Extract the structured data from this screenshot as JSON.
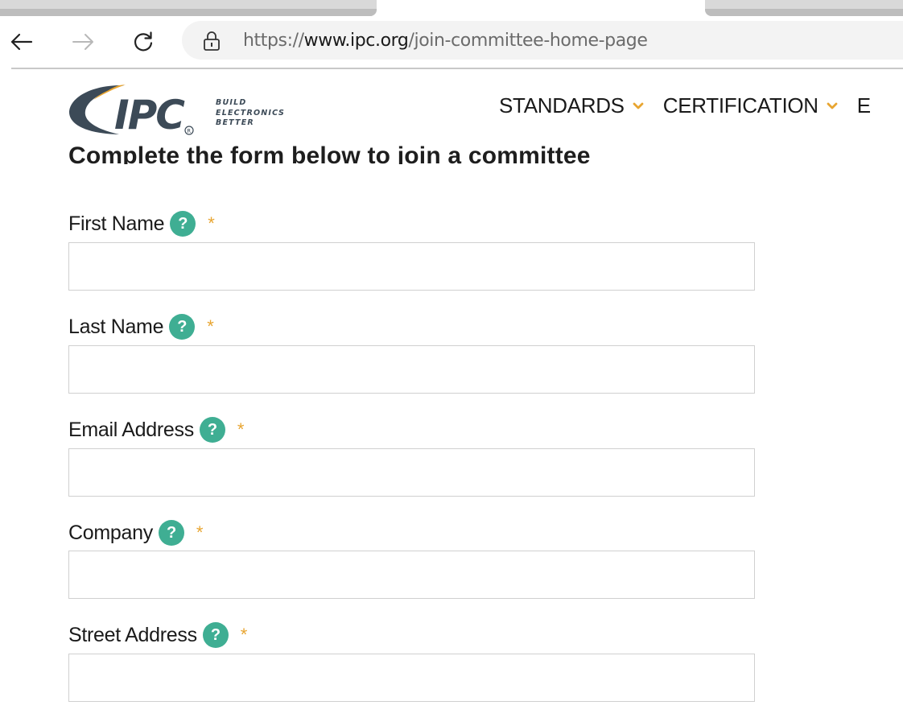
{
  "browser": {
    "url_protocol": "https://",
    "url_host": "www.ipc.org",
    "url_path": "/join-committee-home-page"
  },
  "site": {
    "logo_text": "IPC",
    "tagline": [
      "BUILD",
      "ELECTRONICS",
      "BETTER"
    ],
    "nav": [
      "STANDARDS",
      "CERTIFICATION",
      "E"
    ]
  },
  "form": {
    "heading": "Complete the form below to join a committee",
    "help_glyph": "?",
    "required_glyph": "*",
    "fields": [
      {
        "label": "First Name",
        "value": ""
      },
      {
        "label": "Last Name",
        "value": ""
      },
      {
        "label": "Email Address",
        "value": ""
      },
      {
        "label": "Company",
        "value": ""
      },
      {
        "label": "Street Address",
        "value": ""
      }
    ]
  },
  "colors": {
    "help_badge": "#3fae93",
    "required": "#e8a531",
    "nav_chevron": "#e8a531",
    "logo_dark": "#3c4a57"
  }
}
